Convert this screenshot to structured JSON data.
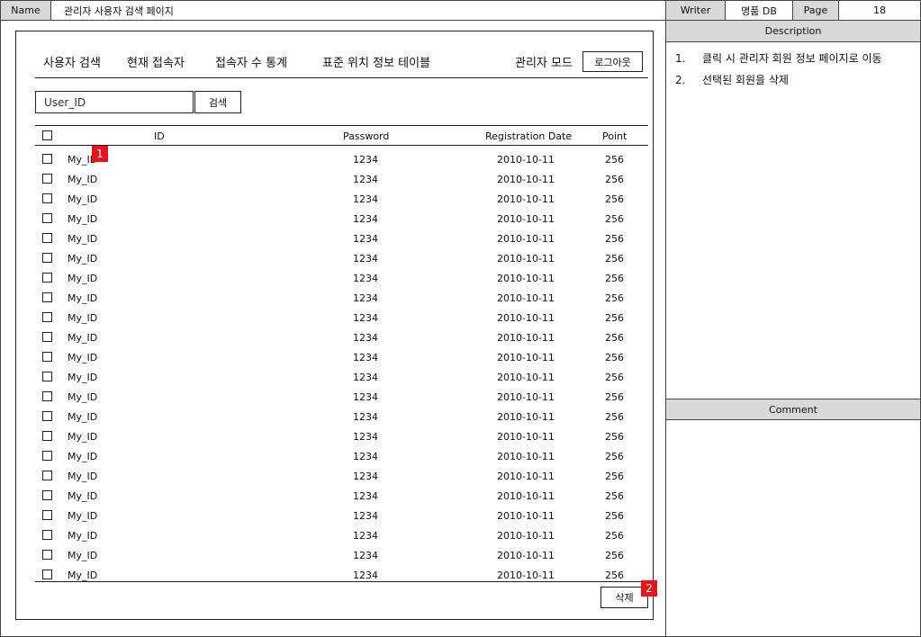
{
  "header": {
    "name_label": "Name",
    "name_value": "관리자 사용자 검색 페이지",
    "writer_label": "Writer",
    "writer_value": "명품 DB",
    "page_label": "Page",
    "page_value": "18"
  },
  "nav": {
    "items": [
      "사용자 검색",
      "현재 접속자",
      "접속자 수 통계",
      "표준 위치 정보 테이블"
    ],
    "admin_mode": "관리자 모드",
    "logout_label": "로그아웃"
  },
  "search": {
    "value": "User_ID",
    "button_label": "검색"
  },
  "table": {
    "columns": [
      "ID",
      "Password",
      "Registration Date",
      "Point"
    ],
    "rows": [
      {
        "id": "My_ID",
        "password": "1234",
        "date": "2010-10-11",
        "point": "256"
      },
      {
        "id": "My_ID",
        "password": "1234",
        "date": "2010-10-11",
        "point": "256"
      },
      {
        "id": "My_ID",
        "password": "1234",
        "date": "2010-10-11",
        "point": "256"
      },
      {
        "id": "My_ID",
        "password": "1234",
        "date": "2010-10-11",
        "point": "256"
      },
      {
        "id": "My_ID",
        "password": "1234",
        "date": "2010-10-11",
        "point": "256"
      },
      {
        "id": "My_ID",
        "password": "1234",
        "date": "2010-10-11",
        "point": "256"
      },
      {
        "id": "My_ID",
        "password": "1234",
        "date": "2010-10-11",
        "point": "256"
      },
      {
        "id": "My_ID",
        "password": "1234",
        "date": "2010-10-11",
        "point": "256"
      },
      {
        "id": "My_ID",
        "password": "1234",
        "date": "2010-10-11",
        "point": "256"
      },
      {
        "id": "My_ID",
        "password": "1234",
        "date": "2010-10-11",
        "point": "256"
      },
      {
        "id": "My_ID",
        "password": "1234",
        "date": "2010-10-11",
        "point": "256"
      },
      {
        "id": "My_ID",
        "password": "1234",
        "date": "2010-10-11",
        "point": "256"
      },
      {
        "id": "My_ID",
        "password": "1234",
        "date": "2010-10-11",
        "point": "256"
      },
      {
        "id": "My_ID",
        "password": "1234",
        "date": "2010-10-11",
        "point": "256"
      },
      {
        "id": "My_ID",
        "password": "1234",
        "date": "2010-10-11",
        "point": "256"
      },
      {
        "id": "My_ID",
        "password": "1234",
        "date": "2010-10-11",
        "point": "256"
      },
      {
        "id": "My_ID",
        "password": "1234",
        "date": "2010-10-11",
        "point": "256"
      },
      {
        "id": "My_ID",
        "password": "1234",
        "date": "2010-10-11",
        "point": "256"
      },
      {
        "id": "My_ID",
        "password": "1234",
        "date": "2010-10-11",
        "point": "256"
      },
      {
        "id": "My_ID",
        "password": "1234",
        "date": "2010-10-11",
        "point": "256"
      },
      {
        "id": "My_ID",
        "password": "1234",
        "date": "2010-10-11",
        "point": "256"
      },
      {
        "id": "My_ID",
        "password": "1234",
        "date": "2010-10-11",
        "point": "256"
      }
    ]
  },
  "delete_label": "삭제",
  "markers": [
    "1",
    "2"
  ],
  "description": {
    "title": "Description",
    "items": [
      {
        "num": "1.",
        "text": "클릭 시 관리자 회원 정보 페이지로 이동"
      },
      {
        "num": "2.",
        "text": "선택된 회원을 삭제"
      }
    ]
  },
  "comment": {
    "title": "Comment"
  },
  "colors": {
    "marker": "#e8141c",
    "header_gray": "#d9d9d9"
  }
}
